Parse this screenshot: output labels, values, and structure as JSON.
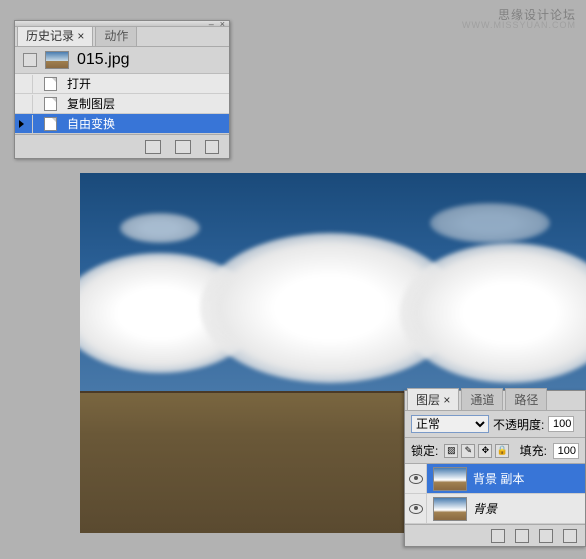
{
  "watermark": {
    "main": "思缘设计论坛",
    "sub": "WWW.MISSYUAN.COM"
  },
  "history": {
    "tabs": {
      "active": "历史记录 ×",
      "inactive": "动作"
    },
    "source": "015.jpg",
    "items": [
      {
        "label": "打开"
      },
      {
        "label": "复制图层"
      },
      {
        "label": "自由变换"
      }
    ]
  },
  "layers": {
    "tabs": {
      "active": "图层 ×",
      "t2": "通道",
      "t3": "路径"
    },
    "blend_mode": "正常",
    "opacity_label": "不透明度:",
    "opacity_value": "100",
    "lock_label": "锁定:",
    "fill_label": "填充:",
    "fill_value": "100",
    "rows": [
      {
        "name": "背景 副本"
      },
      {
        "name": "背景"
      }
    ]
  }
}
